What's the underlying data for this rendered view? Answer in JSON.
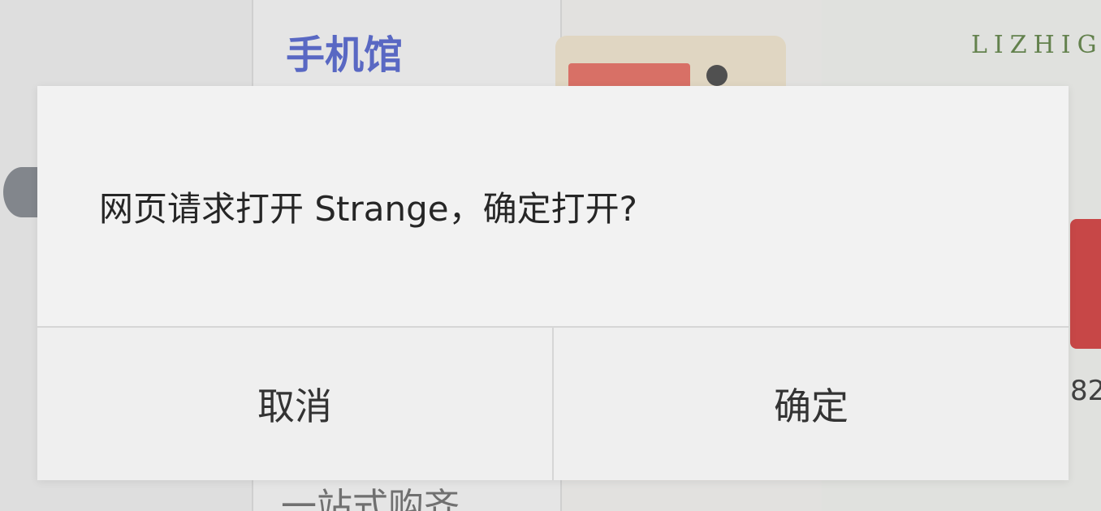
{
  "background": {
    "section_title": "手机馆",
    "brand_text": "LIZHIG",
    "bottom_text": "一站式购齐",
    "price_fragment": "82"
  },
  "dialog": {
    "message": "网页请求打开 Strange，确定打开?",
    "cancel_label": "取消",
    "confirm_label": "确定"
  }
}
